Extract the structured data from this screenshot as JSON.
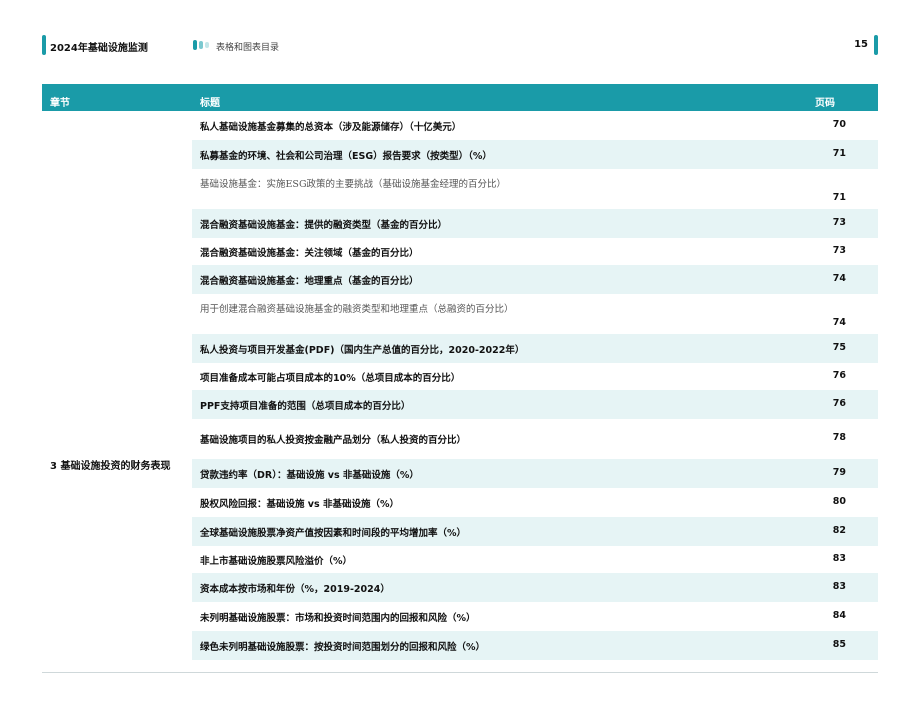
{
  "header": {
    "report_title": "2024年基础设施监测",
    "section_label": "表格和图表目录",
    "page_number": "15",
    "accent_color": "#1a9ba8"
  },
  "table": {
    "columns": {
      "chapter": "章节",
      "title": "标题",
      "page": "页码"
    },
    "chapter_label": "3  基础设施投资的财务表现",
    "rows": [
      {
        "title": "私人基础设施基金募集的总资本（涉及能源储存）（十亿美元）",
        "page": "70"
      },
      {
        "title": "私募基金的环境、社会和公司治理（ESG）报告要求（按类型）（%）",
        "page": "71"
      },
      {
        "title": "基础设施基金：实施ESG政策的主要挑战（基础设施基金经理的百分比）",
        "page": "71"
      },
      {
        "title": "混合融资基础设施基金：提供的融资类型（基金的百分比）",
        "page": "73"
      },
      {
        "title": "混合融资基础设施基金：关注领域（基金的百分比）",
        "page": "73"
      },
      {
        "title": "混合融资基础设施基金：地理重点（基金的百分比）",
        "page": "74"
      },
      {
        "title": "用于创建混合融资基础设施基金的融资类型和地理重点（总融资的百分比）",
        "page": "74"
      },
      {
        "title": "私人投资与项目开发基金(PDF)（国内生产总值的百分比，2020-2022年）",
        "page": "75"
      },
      {
        "title": "项目准备成本可能占项目成本的10%（总项目成本的百分比）",
        "page": "76"
      },
      {
        "title": "PPF支持项目准备的范围（总项目成本的百分比）",
        "page": "76"
      },
      {
        "title": "基础设施项目的私人投资按金融产品划分（私人投资的百分比）",
        "page": "78"
      },
      {
        "title": "贷款违约率（DR）：基础设施 vs 非基础设施（%）",
        "page": "79"
      },
      {
        "title": "股权风险回报：基础设施 vs 非基础设施（%）",
        "page": "80"
      },
      {
        "title": "全球基础设施股票净资产值按因素和时间段的平均增加率（%）",
        "page": "82"
      },
      {
        "title": "非上市基础设施股票风险溢价（%）",
        "page": "83"
      },
      {
        "title": "资本成本按市场和年份（%，2019-2024）",
        "page": "83"
      },
      {
        "title": "未列明基础设施股票：市场和投资时间范围内的回报和风险（%）",
        "page": "84"
      },
      {
        "title": "绿色未列明基础设施股票：按投资时间范围划分的回报和风险（%）",
        "page": "85"
      }
    ]
  }
}
